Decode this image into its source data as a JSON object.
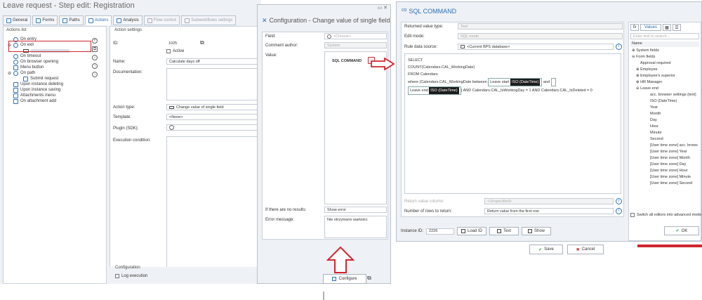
{
  "main": {
    "title": "Leave request - Step edit: Registration",
    "tabs": [
      "General",
      "Forms",
      "Paths",
      "Actions",
      "Analysis",
      "Flow control",
      "Subworkflows settings"
    ],
    "actions_list_title": "Actions list",
    "actions": [
      "On entry",
      "On exit",
      "",
      "On timeout",
      "On browser opening",
      "Menu button",
      "On path",
      "Submit request",
      "Upon instance deleting",
      "Upon instance saving",
      "Attachments menu",
      "On attachment add"
    ],
    "settings_title": "Action settings",
    "id_label": "ID:",
    "id_value": "1025",
    "active_label": "Active",
    "name_label": "Name:",
    "name_value": "Calculate days off",
    "doc_label": "Documentation:",
    "type_label": "Action type:",
    "type_value": "Change value of single field",
    "template_label": "Template:",
    "template_value": "<None>",
    "plugin_label": "Plugin (SDK):",
    "exec_label": "Execution condition:",
    "config_title": "Configuration",
    "log_label": "Log execution",
    "configure_label": "Configure"
  },
  "cfg": {
    "title": "Configuration - Change value of single field",
    "field_label": "Field:",
    "field_value": "<Choose>",
    "author_label": "Comment author:",
    "author_value": "System",
    "value_label": "Value:",
    "value_text": "SQL COMMAND",
    "noresults_label": "If there are no results:",
    "noresults_value": "Show error",
    "error_label": "Error message:",
    "error_value": "Nie otrzymano wartości."
  },
  "sql": {
    "title": "SQL COMMAND",
    "rvt_label": "Returned value type:",
    "rvt_value": "Text",
    "edit_label": "Edit mode:",
    "edit_value": "SQL mode",
    "rds_label": "Rule data source:",
    "rds_value": "<Current BPS database>",
    "code": {
      "l1": "SELECT",
      "l2": "COUNT(Calendars.CAL_WorkingDate)",
      "l3": "FROM Calendars",
      "l4a": "where (Calendars.CAL_WorkingDate between",
      "tok1": "Leave start",
      "tok_type": "ISO (DateTime)",
      "l4b": "and",
      "tok2": "Leave end",
      "l5b": ") AND Calendars.CAL_IsWorkingDay = 1 AND Calendars.CAL_IsDeleted = 0"
    },
    "rvc_label": "Return value column:",
    "rvc_value": "<Unspecified>",
    "rows_label": "Number of rows to return:",
    "rows_value": "Return value from the first row",
    "instance_label": "Instance ID:",
    "instance_value": "2226",
    "load_label": "Load ID",
    "text_label": "Text",
    "show_label": "Show",
    "save_label": "Save",
    "cancel_label": "Cancel",
    "ok_label": "OK",
    "values_tab": "Values",
    "filter_placeholder": "Enter text to search...",
    "name_col": "Name",
    "tree": [
      "System fields",
      "Form fields",
      "Approval required",
      "Employee",
      "Employee's superior",
      "HR Manager",
      "Leave end",
      "acc. browser settings (text)",
      "ISO (DateTime)",
      "Year",
      "Month",
      "Day",
      "Hour",
      "Minute",
      "Second",
      "[User time zone] acc. brows",
      "[User time zone] Year",
      "[User time zone] Month",
      "[User time zone] Day",
      "[User time zone] Hour",
      "[User time zone] Minute",
      "[User time zone] Second"
    ],
    "switch_label": "Switch all editors into advanced mode"
  }
}
